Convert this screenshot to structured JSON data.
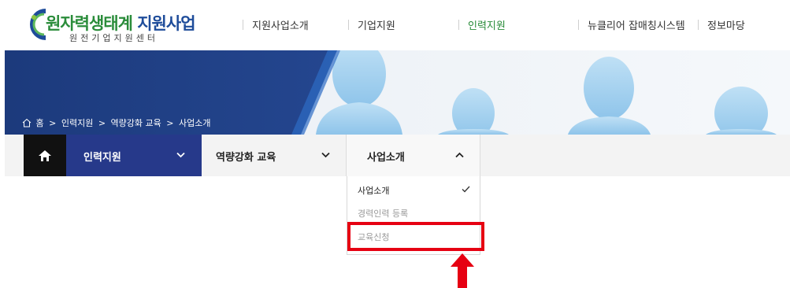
{
  "header": {
    "logo_title_green": "원자력생태계",
    "logo_title_blue": "지원사업",
    "logo_subtitle": "원전기업지원센터",
    "nav": [
      {
        "label": "지원사업소개",
        "active": false
      },
      {
        "label": "기업지원",
        "active": false
      },
      {
        "label": "인력지원",
        "active": true
      },
      {
        "label": "뉴클리어 잡매칭시스템",
        "active": false
      },
      {
        "label": "정보마당",
        "active": false
      }
    ]
  },
  "breadcrumb": {
    "home": "홈",
    "sep": ">",
    "level1": "인력지원",
    "level2": "역량강화 교육",
    "level3": "사업소개"
  },
  "subnav": {
    "level1": "인력지원",
    "level2": "역량강화 교육",
    "level3": "사업소개"
  },
  "dropdown": {
    "items": [
      {
        "label": "사업소개",
        "selected": true
      },
      {
        "label": "경력인력 등록",
        "selected": false
      },
      {
        "label": "교육신청",
        "selected": false
      }
    ]
  },
  "colors": {
    "brand_green": "#2a8c3a",
    "brand_blue": "#1e4c9a",
    "subnav_blue": "#26398a",
    "highlight_red": "#e60012"
  }
}
